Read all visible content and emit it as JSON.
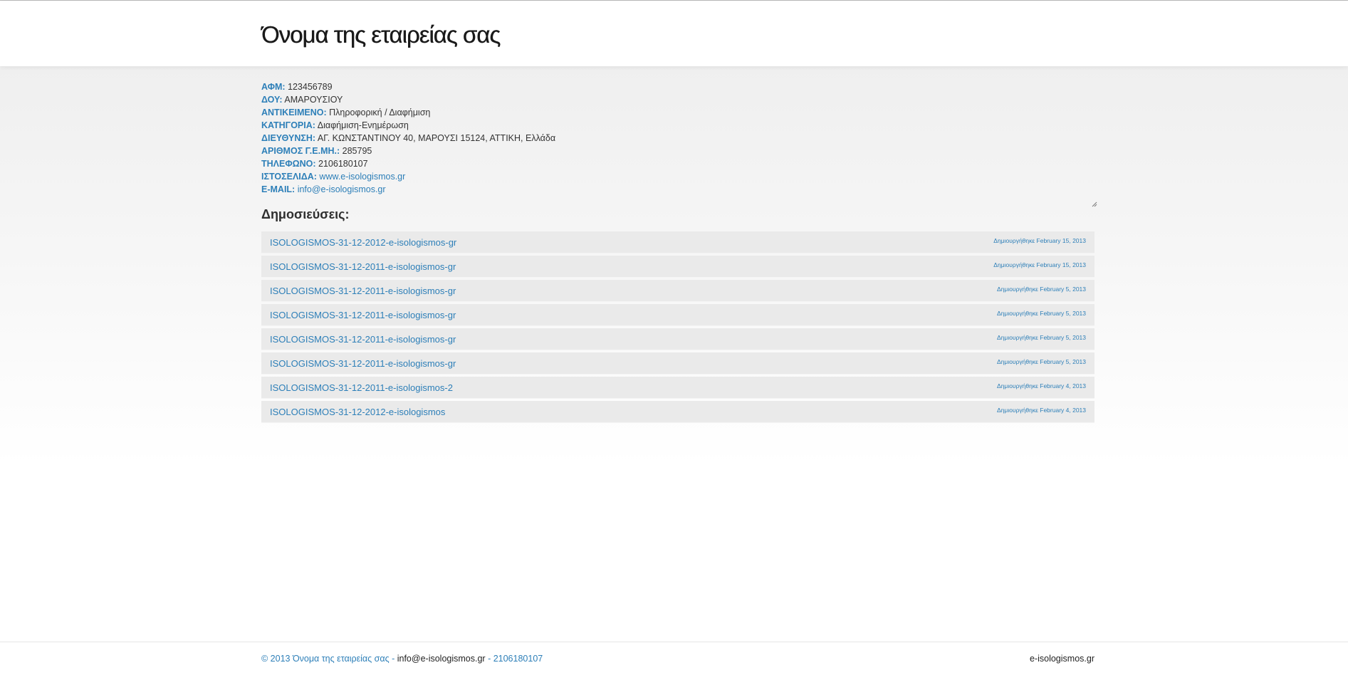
{
  "header": {
    "title": "Όνομα της εταιρείας σας"
  },
  "company": {
    "fields": [
      {
        "label": "ΑΦΜ:",
        "value": "123456789",
        "link": false
      },
      {
        "label": "ΔΟΥ:",
        "value": "ΑΜΑΡΟΥΣΙΟΥ",
        "link": false
      },
      {
        "label": "ΑΝΤΙΚΕΙΜΕΝΟ:",
        "value": "Πληροφορική / Διαφήμιση",
        "link": false
      },
      {
        "label": "ΚΑΤΗΓΟΡΙΑ:",
        "value": "Διαφήμιση-Ενημέρωση",
        "link": false
      },
      {
        "label": "ΔΙΕΥΘΥΝΣΗ:",
        "value": "ΑΓ. ΚΩΝΣΤΑΝΤΙΝΟΥ 40, ΜΑΡΟΥΣΙ 15124, ΑΤΤΙΚΗ, Ελλάδα",
        "link": false
      },
      {
        "label": "ΑΡΙΘΜΟΣ Γ.Ε.ΜΗ.:",
        "value": "285795",
        "link": false
      },
      {
        "label": "ΤΗΛΕΦΩΝΟ:",
        "value": "2106180107",
        "link": false
      },
      {
        "label": "ΙΣΤΟΣΕΛΙΔΑ:",
        "value": "www.e-isologismos.gr",
        "link": true
      },
      {
        "label": "E-MAIL:",
        "value": "info@e-isologismos.gr",
        "link": true
      }
    ]
  },
  "publications": {
    "heading": "Δημοσιεύσεις:",
    "items": [
      {
        "title": "ISOLOGISMOS-31-12-2012-e-isologismos-gr",
        "date": "Δημιουργήθηκε February 15, 2013"
      },
      {
        "title": "ISOLOGISMOS-31-12-2011-e-isologismos-gr",
        "date": "Δημιουργήθηκε February 15, 2013"
      },
      {
        "title": "ISOLOGISMOS-31-12-2011-e-isologismos-gr",
        "date": "Δημιουργήθηκε February 5, 2013"
      },
      {
        "title": "ISOLOGISMOS-31-12-2011-e-isologismos-gr",
        "date": "Δημιουργήθηκε February 5, 2013"
      },
      {
        "title": "ISOLOGISMOS-31-12-2011-e-isologismos-gr",
        "date": "Δημιουργήθηκε February 5, 2013"
      },
      {
        "title": "ISOLOGISMOS-31-12-2011-e-isologismos-gr",
        "date": "Δημιουργήθηκε February 5, 2013"
      },
      {
        "title": "ISOLOGISMOS-31-12-2011-e-isologismos-2",
        "date": "Δημιουργήθηκε February 4, 2013"
      },
      {
        "title": "ISOLOGISMOS-31-12-2012-e-isologismos",
        "date": "Δημιουργήθηκε February 4, 2013"
      }
    ]
  },
  "footer": {
    "copyright": "© 2013 Όνομα της εταιρείας σας",
    "sep1": " - ",
    "email": "info@e-isologismos.gr",
    "sep2": " - ",
    "phone": "2106180107",
    "brand": "e-isologismos.gr"
  },
  "colors": {
    "accent": "#2d7fb8",
    "row_bg": "#eaeaea",
    "text": "#333333"
  }
}
